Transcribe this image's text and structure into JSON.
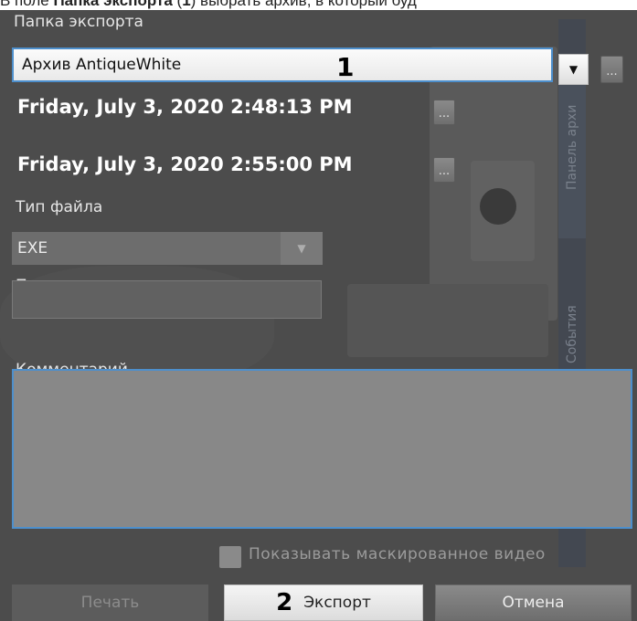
{
  "caption": {
    "prefix": "В поле ",
    "bold1": "Папка экспорта",
    "open": " (",
    "bold2": "1",
    "rest": ") выбрать архив, в который буд"
  },
  "side_tabs": {
    "archive_panel": "Панель архи",
    "events": "События"
  },
  "export_folder": {
    "label": "Папка экспорта",
    "value": "Архив AntiqueWhite",
    "browse_label": "...",
    "marker": "1"
  },
  "time_range": {
    "start": "Friday, July 3, 2020 2:48:13 PM",
    "end": "Friday, July 3, 2020 2:55:00 PM",
    "picker_label": "..."
  },
  "file_type": {
    "label": "Тип файла",
    "value": "EXE"
  },
  "password": {
    "label": "Пароль",
    "value": ""
  },
  "comment": {
    "label": "Комментарий",
    "value": ""
  },
  "masked_video": {
    "label": "Показывать маскированное видео",
    "checked": false
  },
  "buttons": {
    "print": "Печать",
    "export": "Экспорт",
    "export_marker": "2",
    "cancel": "Отмена"
  },
  "colors": {
    "panel_bg": "#4c4c4c",
    "focus_border": "#4d8fcc"
  }
}
